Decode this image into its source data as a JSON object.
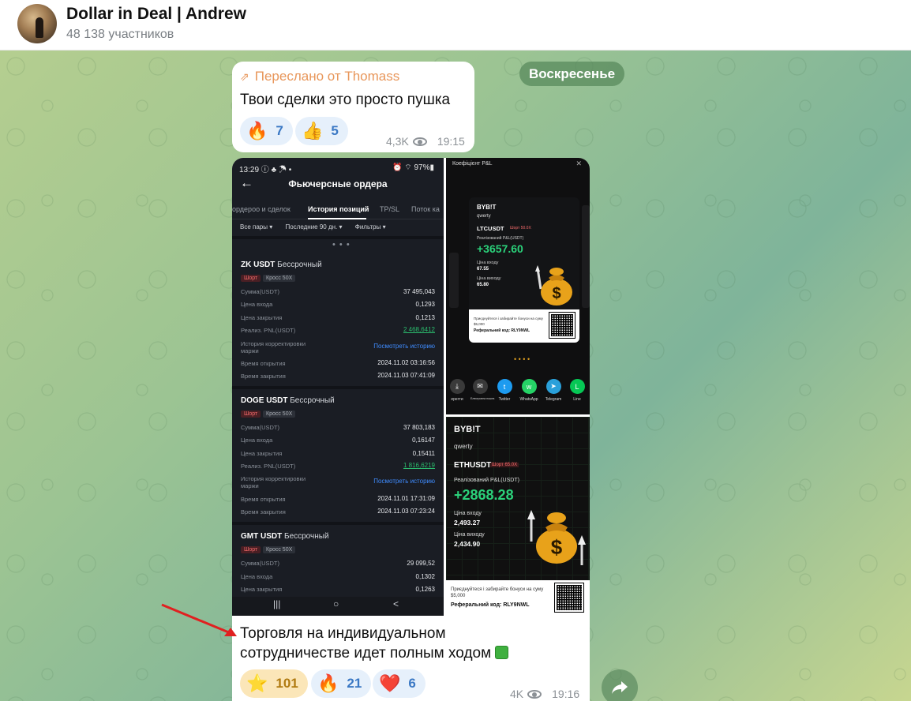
{
  "header": {
    "title": "Dollar in Deal | Andrew",
    "subtitle": "48 138 участников"
  },
  "date_separator": "Воскресенье",
  "message1": {
    "forwarded_from": "Переслано от Thomass",
    "text": "Твои сделки это просто пушка",
    "reactions": [
      {
        "emoji": "🔥",
        "count": "7"
      },
      {
        "emoji": "👍",
        "count": "5"
      }
    ],
    "views": "4,3K",
    "time": "19:15"
  },
  "message2": {
    "screenshot_left": {
      "status_time": "13:29 ⓘ ♣ ☂ •",
      "status_right": "⏰ ⌔ 97%▮",
      "title": "Фьючерсные ордера",
      "tabs": [
        "ордерoо и сделок",
        "История позиций",
        "TP/SL",
        "Поток ка"
      ],
      "filters": [
        "Все пары ▾",
        "Последние 90 дн. ▾",
        "Фильтры ▾"
      ],
      "dots": "• • •",
      "orders": [
        {
          "pair": "ZK USDT",
          "kind": "Бессрочный",
          "tag_short": "Шорт",
          "tag_cross": "Кросс 50X",
          "amount_label": "Сумма(USDT)",
          "amount": "37 495,043",
          "entry_label": "Цена входа",
          "entry": "0,1293",
          "exit_label": "Цена закрытия",
          "exit": "0,1213",
          "pnl_label": "Реализ. PNL(USDT)",
          "pnl": "2 468,6412",
          "history_label": "История корректировки маржи",
          "history_link": "Посмотреть историю",
          "open_label": "Время открытия",
          "open": "2024.11.02 03:16:56",
          "close_label": "Время закрытия",
          "close": "2024.11.03 07:41:09"
        },
        {
          "pair": "DOGE USDT",
          "kind": "Бессрочный",
          "tag_short": "Шорт",
          "tag_cross": "Кросс 50X",
          "amount_label": "Сумма(USDT)",
          "amount": "37 803,183",
          "entry_label": "Цена входа",
          "entry": "0,16147",
          "exit_label": "Цена закрытия",
          "exit": "0,15411",
          "pnl_label": "Реализ. PNL(USDT)",
          "pnl": "1 816,6219",
          "history_label": "История корректировки маржи",
          "history_link": "Посмотреть историю",
          "open_label": "Время открытия",
          "open": "2024.11.01 17:31:09",
          "close_label": "Время закрытия",
          "close": "2024.11.03 07:23:24"
        },
        {
          "pair": "GMT USDT",
          "kind": "Бессрочный",
          "tag_short": "Шорт",
          "tag_cross": "Кросс 50X",
          "amount_label": "Сумма(USDT)",
          "amount": "29 099,52",
          "entry_label": "Цена входа",
          "entry": "0,1302",
          "exit_label": "Цена закрытия",
          "exit": "0,1263"
        }
      ],
      "nav": [
        "|||",
        "○",
        "<"
      ]
    },
    "screenshot_top_right": {
      "header": "Коефіцієнт P&L",
      "close": "✕",
      "brand": "BYB!T",
      "user": "qwerty",
      "pair": "LTCUSDT",
      "side": "Шорт 50.0X",
      "pnl_label": "Реалізований P&L(USDT)",
      "pnl": "+3657.60",
      "entry_label": "Ціна входу",
      "entry": "67.55",
      "exit_label": "Ціна виходу",
      "exit": "65.80",
      "bonus_text": "Приєднуйтеся і забирайте бонуси на суму $5,000",
      "ref_code": "Реферальний код: RLY9NWL",
      "pager": "• • • •",
      "share_targets": [
        {
          "label": "ерегти",
          "color": "#3a3a3a",
          "icon": "⤓"
        },
        {
          "label": "Електронна пошта",
          "color": "#3a3a3a",
          "icon": "✉"
        },
        {
          "label": "Twitter",
          "color": "#1d9bf0",
          "icon": "t"
        },
        {
          "label": "WhatsApp",
          "color": "#25d366",
          "icon": "w"
        },
        {
          "label": "Telegram",
          "color": "#2aa0da",
          "icon": "➤"
        },
        {
          "label": "Line",
          "color": "#06c755",
          "icon": "L"
        }
      ]
    },
    "screenshot_bottom_right": {
      "brand": "BYB!T",
      "user": "qwerty",
      "pair": "ETHUSDT",
      "side": "Шорт 65.0X",
      "pnl_label": "Реалізований P&L(USDT)",
      "pnl": "+2868.28",
      "entry_label": "Ціна входу",
      "entry": "2,493.27",
      "exit_label": "Ціна виходу",
      "exit": "2,434.90",
      "bonus_text": "Приєднуйтеся і забирайте бонуси на суму $5,000",
      "ref_code": "Реферальний код: RLY9NWL"
    },
    "text_line1": "Торговля на индивидуальном",
    "text_line2": "сотрудничестве идет полным ходом",
    "reactions": [
      {
        "emoji": "⭐",
        "count": "101"
      },
      {
        "emoji": "🔥",
        "count": "21"
      },
      {
        "emoji": "❤️",
        "count": "6"
      }
    ],
    "views": "4K",
    "time": "19:16"
  },
  "colors": {
    "accent_blue": "#3a78c4",
    "forward_orange": "#e8965a",
    "profit_green": "#2bd17a",
    "short_red": "#f46b6b"
  }
}
